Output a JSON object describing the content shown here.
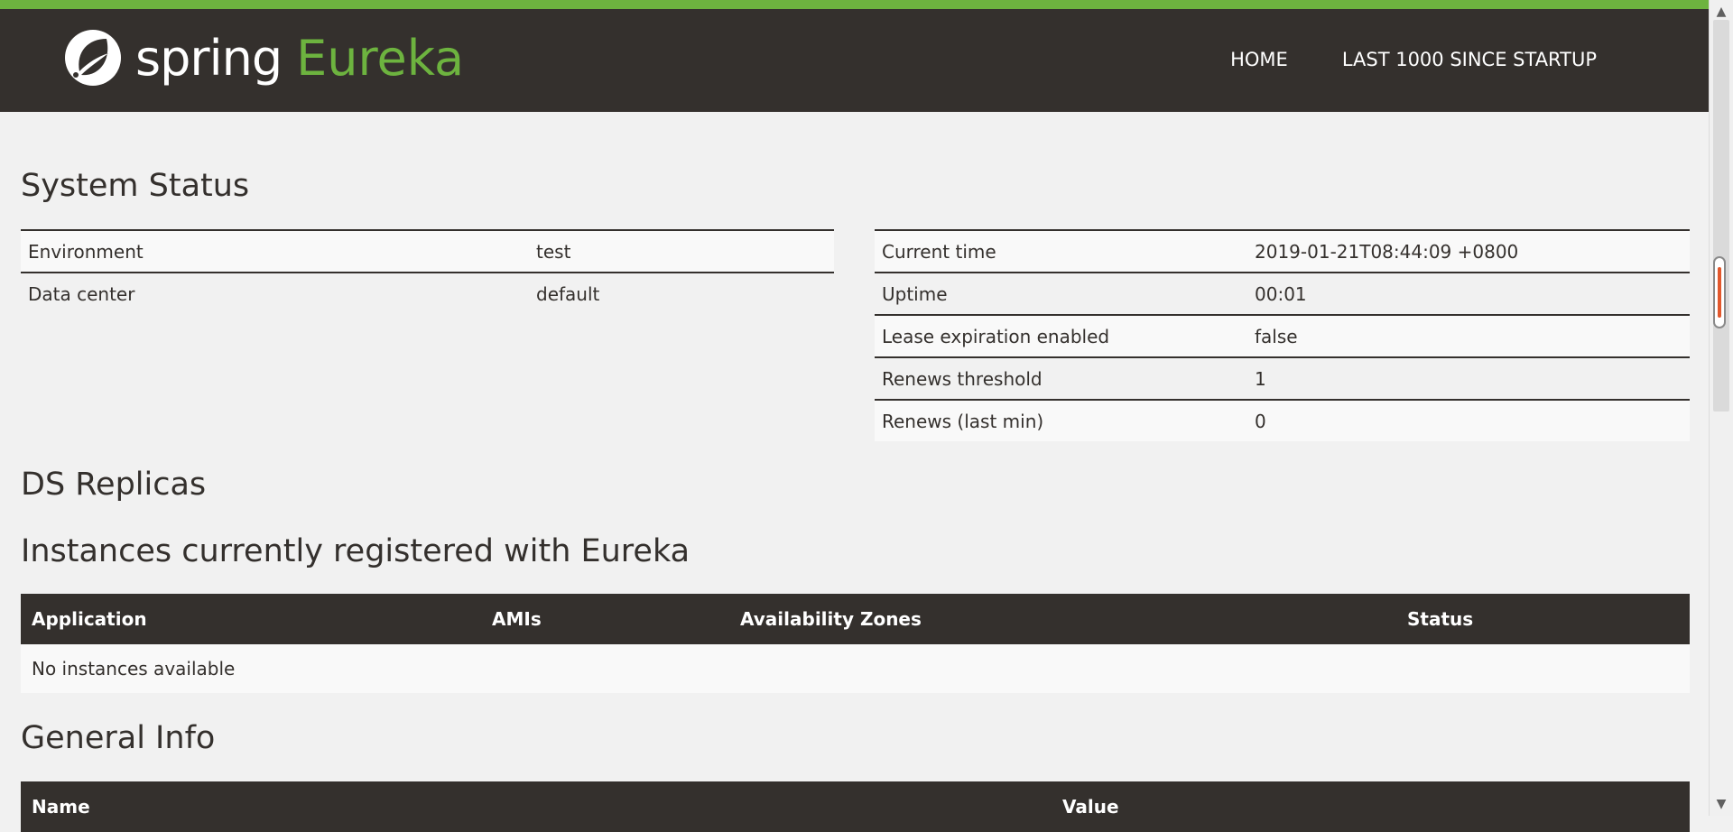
{
  "colors": {
    "accent": "#6db33f",
    "navbar": "#34302d",
    "background": "#f1f1f1",
    "row_alt": "#f9f9f9",
    "scroll_grip": "#e2572c"
  },
  "brand": {
    "word1": "spring",
    "word2": "Eureka",
    "logo_icon": "spring-leaf-icon"
  },
  "nav": {
    "home": "HOME",
    "last1000": "LAST 1000 SINCE STARTUP"
  },
  "system_status": {
    "title": "System Status",
    "left": [
      {
        "key": "Environment",
        "value": "test"
      },
      {
        "key": "Data center",
        "value": "default"
      }
    ],
    "right": [
      {
        "key": "Current time",
        "value": "2019-01-21T08:44:09 +0800"
      },
      {
        "key": "Uptime",
        "value": "00:01"
      },
      {
        "key": "Lease expiration enabled",
        "value": "false"
      },
      {
        "key": "Renews threshold",
        "value": "1"
      },
      {
        "key": "Renews (last min)",
        "value": "0"
      }
    ]
  },
  "ds_replicas": {
    "title": "DS Replicas"
  },
  "instances": {
    "title": "Instances currently registered with Eureka",
    "headers": [
      "Application",
      "AMIs",
      "Availability Zones",
      "Status"
    ],
    "empty_text": "No instances available"
  },
  "general_info": {
    "title": "General Info",
    "headers": [
      "Name",
      "Value"
    ]
  }
}
